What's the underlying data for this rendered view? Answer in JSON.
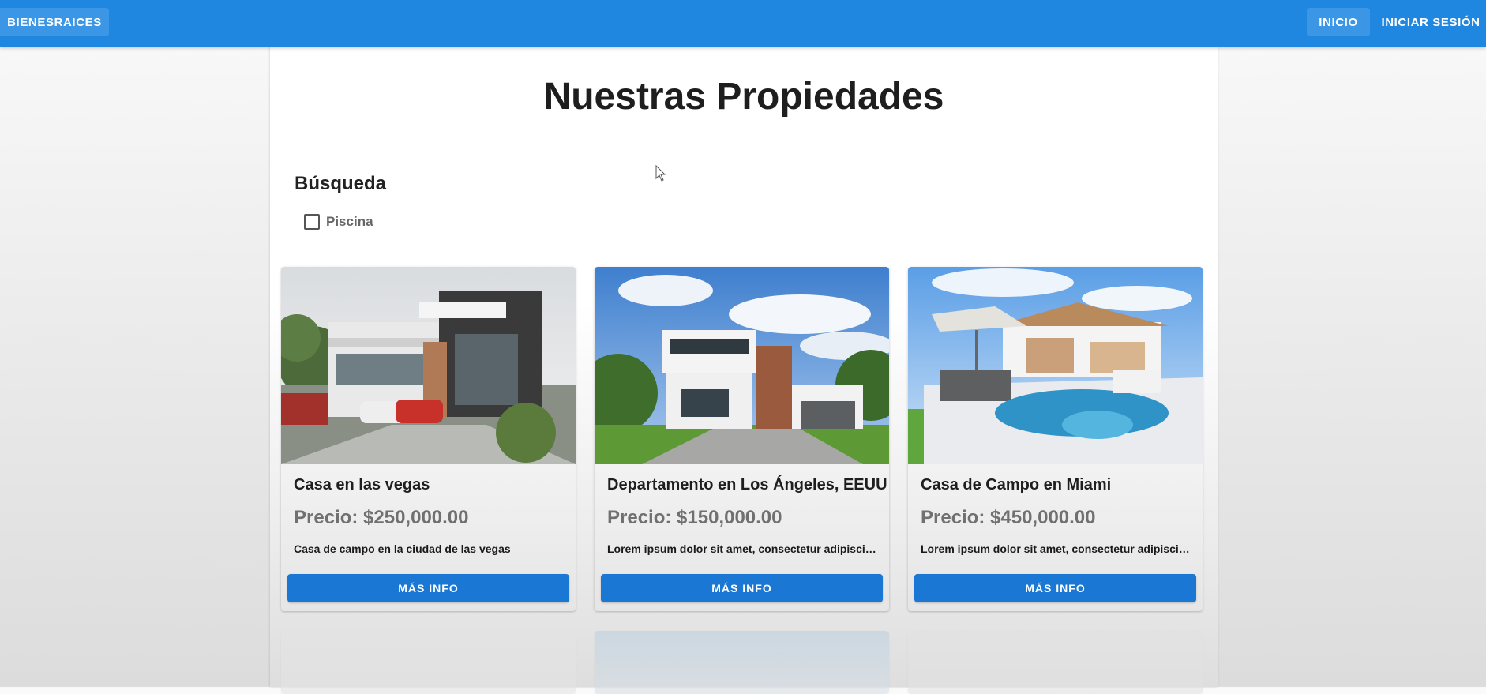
{
  "header": {
    "brand": "BIENESRAICES",
    "nav": {
      "home": "INICIO",
      "login": "INICIAR SESIÓN"
    },
    "color": "#2087e1"
  },
  "page": {
    "title": "Nuestras Propiedades"
  },
  "search": {
    "heading": "Búsqueda",
    "filters": [
      {
        "label": "Piscina",
        "checked": false
      }
    ]
  },
  "cards": [
    {
      "title": "Casa en las vegas",
      "price": "Precio: $250,000.00",
      "description": "Casa de campo en la ciudad de las vegas",
      "button": "MÁS INFO"
    },
    {
      "title": "Departamento en Los Ángeles, EEUU",
      "price": "Precio: $150,000.00",
      "description": "Lorem ipsum dolor sit amet, consectetur adipiscing elit.",
      "button": "MÁS INFO"
    },
    {
      "title": "Casa de Campo en Miami",
      "price": "Precio: $450,000.00",
      "description": "Lorem ipsum dolor sit amet, consectetur adipiscing elit.",
      "button": "MÁS INFO"
    }
  ],
  "colors": {
    "primary": "#1a78d4",
    "price": "#707070"
  }
}
